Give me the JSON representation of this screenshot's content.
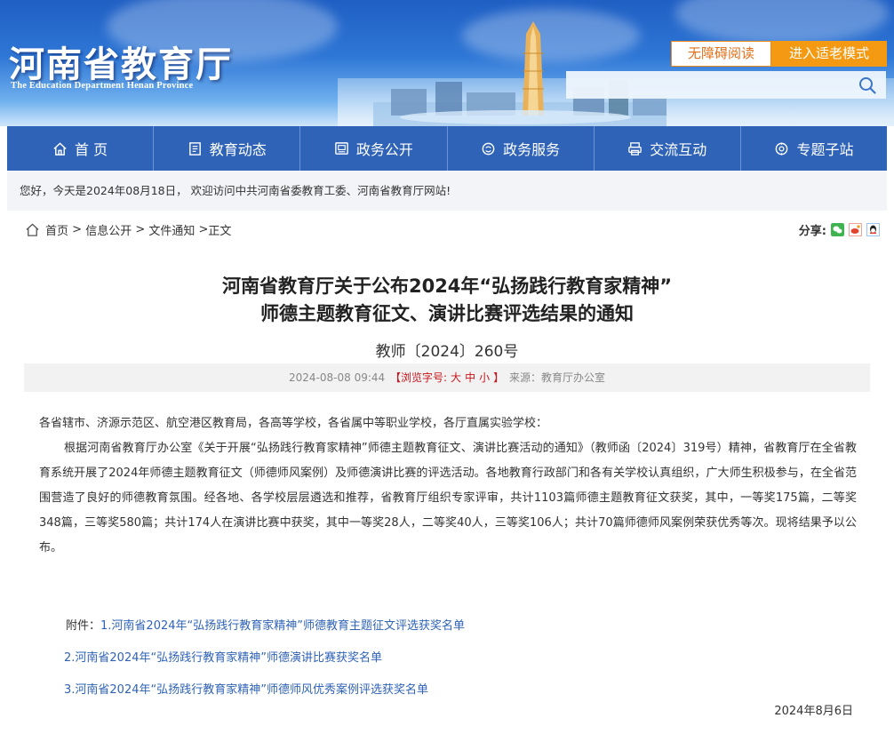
{
  "header": {
    "site_title": "河南省教育厅",
    "site_subtitle": "The Education Department Henan Province",
    "accessibility_label": "无障碍阅读",
    "elder_mode_label": "进入适老模式",
    "search_placeholder": ""
  },
  "nav": {
    "items": [
      {
        "label": "首 页",
        "icon": "home-icon"
      },
      {
        "label": "教育动态",
        "icon": "news-icon"
      },
      {
        "label": "政务公开",
        "icon": "public-icon"
      },
      {
        "label": "政务服务",
        "icon": "service-icon"
      },
      {
        "label": "交流互动",
        "icon": "interaction-icon"
      },
      {
        "label": "专题子站",
        "icon": "topic-icon"
      }
    ]
  },
  "welcome": {
    "text": "您好，今天是2024年08月18日， 欢迎访问中共河南省委教育工委、河南省教育厅网站!"
  },
  "breadcrumb": {
    "items": [
      "首页",
      " > ",
      "信息公开",
      " > ",
      "文件通知",
      " >",
      "正文"
    ]
  },
  "share": {
    "label": "分享:",
    "icons": [
      "wechat-icon",
      "weibo-icon",
      "qq-icon"
    ]
  },
  "article": {
    "title_line1": "河南省教育厅关于公布2024年“弘扬践行教育家精神”",
    "title_line2": "师德主题教育征文、演讲比赛评选结果的通知",
    "doc_number": "教师〔2024〕260号",
    "date": "2024-08-08 09:44",
    "font_size_label": "【浏览字号:",
    "font_size_options": [
      "大",
      "中",
      "小"
    ],
    "font_size_close": "】",
    "source": "来源：教育厅办公室",
    "salutation": "各省辖市、济源示范区、航空港区教育局，各高等学校，各省属中等职业学校，各厅直属实验学校：",
    "paragraph1": "根据河南省教育厅办公室《关于开展“弘扬践行教育家精神”师德主题教育征文、演讲比赛活动的通知》（教师函〔2024〕319号）精神，省教育厅在全省教育系统开展了2024年师德主题教育征文（师德师风案例）及师德演讲比赛的评选活动。各地教育行政部门和各有关学校认真组织，广大师生积极参与，在全省范围营造了良好的师德教育氛围。经各地、各学校层层遴选和推荐，省教育厅组织专家评审，共计1103篇师德主题教育征文获奖，其中，一等奖175篇，二等奖348篇，三等奖580篇；共计174人在演讲比赛中获奖，其中一等奖28人，二等奖40人，三等奖106人；共计70篇师德师风案例荣获优秀等次。现将结果予以公布。",
    "attachments_label": "附件：",
    "attachments": [
      "1.河南省2024年“弘扬践行教育家精神”师德教育主题征文评选获奖名单",
      "2.河南省2024年“弘扬践行教育家精神”师德演讲比赛获奖名单",
      "3.河南省2024年“弘扬践行教育家精神”师德师风优秀案例评选获奖名单"
    ],
    "sign_date": "2024年8月6日"
  },
  "colors": {
    "nav_bg": "#2f63b8",
    "accent_orange": "#f39a12",
    "link_blue": "#2f63b8",
    "font_size_red": "#c8161d"
  }
}
